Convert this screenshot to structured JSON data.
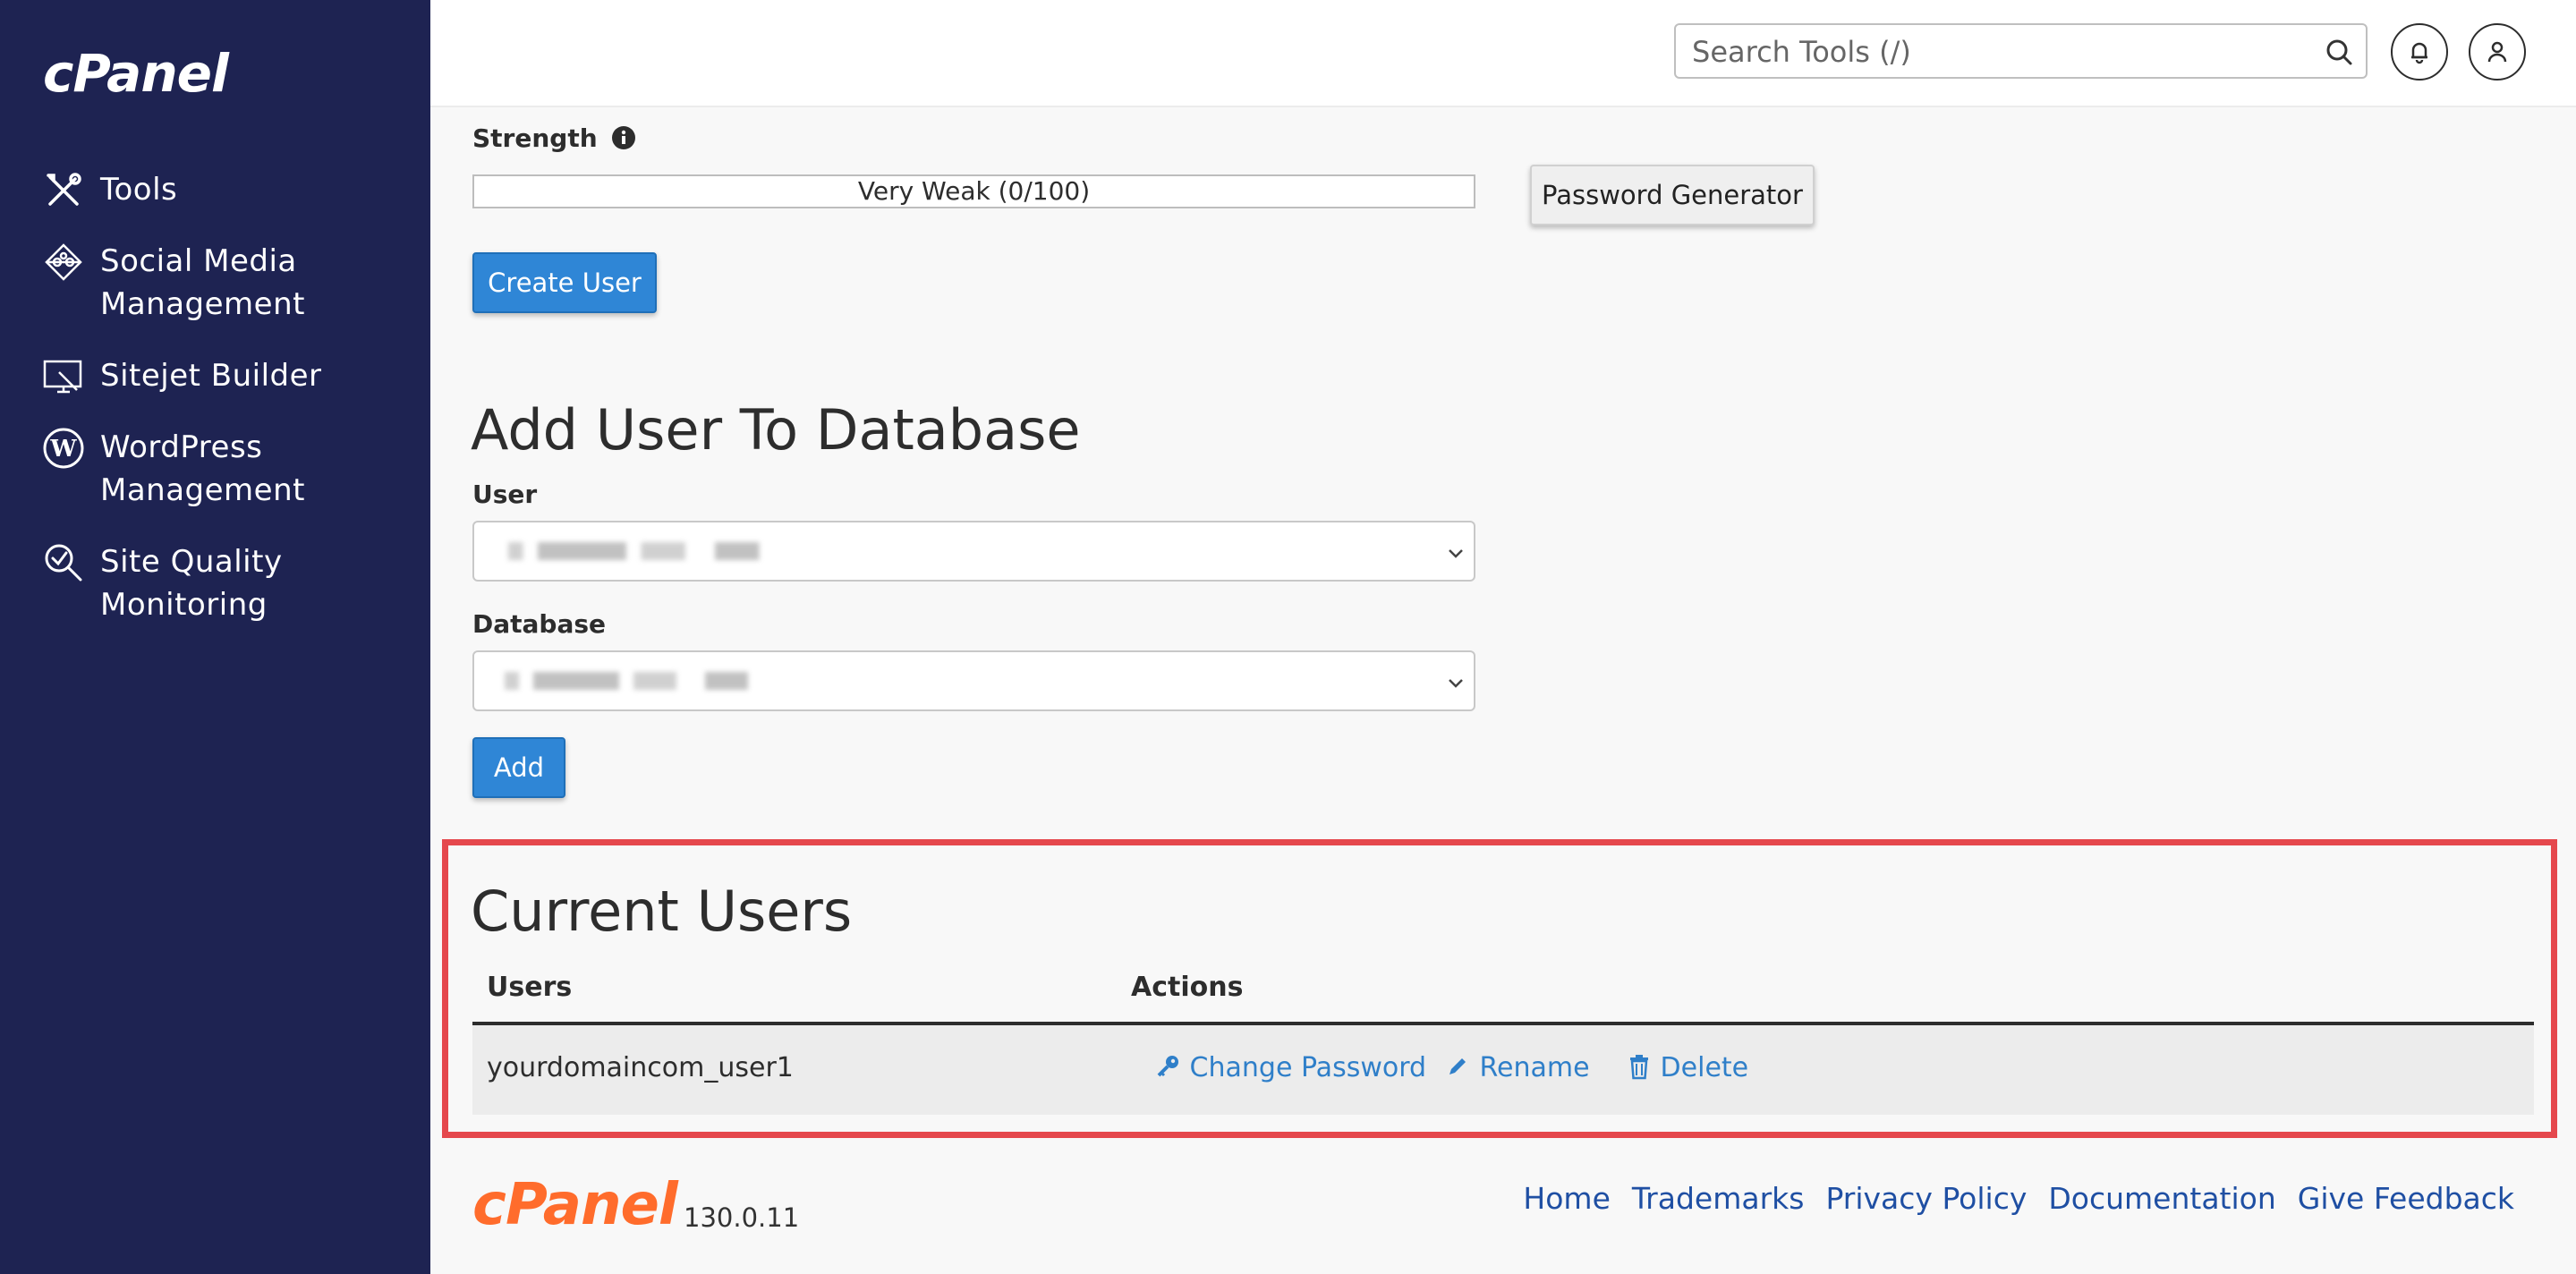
{
  "brand": {
    "logo_text": "cPanel",
    "version": "130.0.11"
  },
  "sidebar": {
    "items": [
      {
        "label": "Tools",
        "icon": "tools-icon"
      },
      {
        "label": "Social Media\nManagement",
        "icon": "social-media-icon"
      },
      {
        "label": "Sitejet Builder",
        "icon": "sitejet-icon"
      },
      {
        "label": "WordPress\nManagement",
        "icon": "wordpress-icon"
      },
      {
        "label": "Site Quality\nMonitoring",
        "icon": "site-quality-icon"
      }
    ]
  },
  "header": {
    "search": {
      "placeholder": "Search Tools (/)",
      "value": ""
    },
    "notifications_icon": "bell-icon",
    "account_icon": "user-icon"
  },
  "create_user": {
    "strength_label": "Strength",
    "strength_value": "Very Weak (0/100)",
    "password_generator_label": "Password Generator",
    "create_button_label": "Create User"
  },
  "add_user_to_db": {
    "heading": "Add User To Database",
    "user_label": "User",
    "database_label": "Database",
    "add_button_label": "Add"
  },
  "current_users": {
    "heading": "Current Users",
    "columns": [
      "Users",
      "Actions"
    ],
    "rows": [
      {
        "user": "yourdomaincom_user1",
        "actions": [
          "Change Password",
          "Rename",
          "Delete"
        ]
      }
    ]
  },
  "footer": {
    "links": [
      "Home",
      "Trademarks",
      "Privacy Policy",
      "Documentation",
      "Give Feedback"
    ]
  },
  "colors": {
    "sidebar_bg": "#1e2352",
    "primary": "#2f86d6",
    "highlight": "#e5484d",
    "footer_logo": "#ff6c2c"
  }
}
